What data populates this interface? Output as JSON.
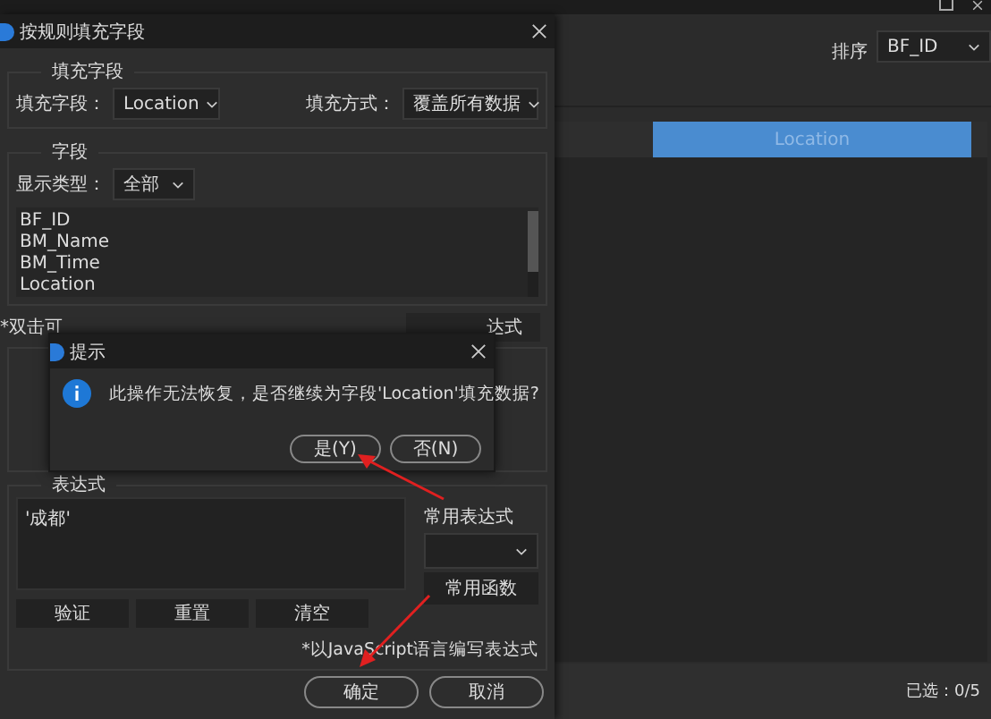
{
  "app": {
    "sort_label": "排序",
    "sort_value": "BF_ID",
    "table_header": "Location",
    "status": "已选：0/5"
  },
  "dialog": {
    "title": "按规则填充字段",
    "fill_group": {
      "legend": "填充字段",
      "field_label": "填充字段：",
      "field_value": "Location",
      "mode_label": "填充方式：",
      "mode_value": "覆盖所有数据"
    },
    "field_group": {
      "legend": "字段",
      "type_label": "显示类型：",
      "type_value": "全部",
      "fields": [
        "BF_ID",
        "BM_Name",
        "BM_Time",
        "Location"
      ]
    },
    "hint_label": "*双击可",
    "hidden_button": "达式",
    "expr_group": {
      "legend": "表达式",
      "value": "'成都'",
      "common_label": "常用表达式",
      "functions_button": "常用函数",
      "buttons": [
        "验证",
        "重置",
        "清空"
      ],
      "note": "*以JavaScript语言编写表达式"
    },
    "buttons": [
      "确定",
      "取消"
    ]
  },
  "message_box": {
    "title": "提示",
    "text": "此操作无法恢复，是否继续为字段'Location'填充数据?",
    "buttons": [
      "是(Y)",
      "否(N)"
    ]
  }
}
